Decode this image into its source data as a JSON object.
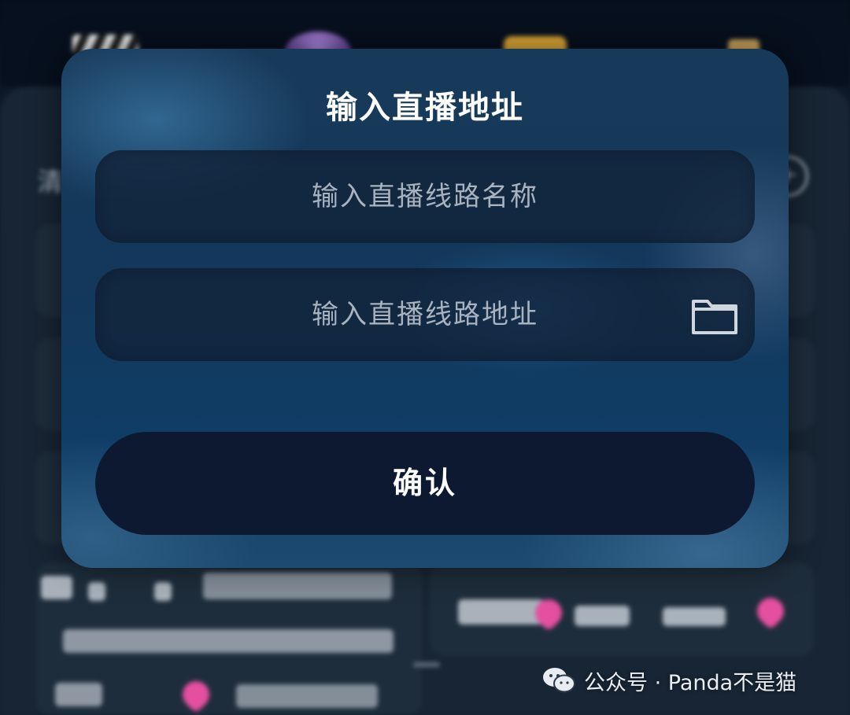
{
  "dialog": {
    "title": "输入直播地址",
    "name_field": {
      "placeholder": "输入直播线路名称",
      "value": ""
    },
    "url_field": {
      "placeholder": "输入直播线路地址",
      "value": ""
    },
    "folder_icon": "folder-icon",
    "confirm_label": "确认"
  },
  "background": {
    "partial_label": "清",
    "add_icon": "plus-circle-icon"
  },
  "watermark": {
    "icon": "wechat-logo",
    "text": "公众号 · Panda不是猫"
  },
  "colors": {
    "dialog_top": "#183a5a",
    "dialog_bottom": "#0f3d66",
    "field_bg": "#122238",
    "button_bg": "#0c1930",
    "text_primary": "#ffffff",
    "placeholder": "#a8b3bf"
  }
}
